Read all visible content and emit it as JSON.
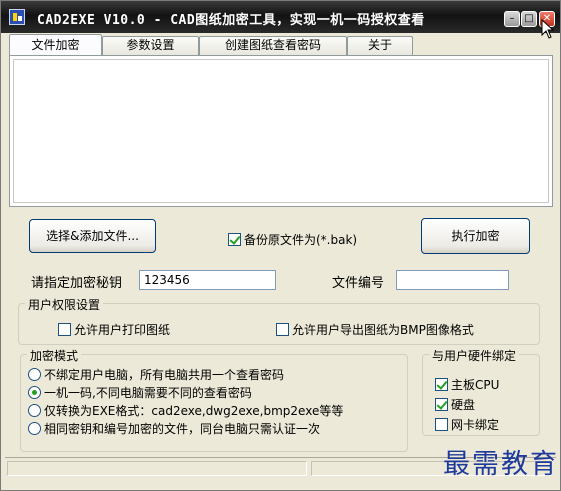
{
  "window": {
    "title": "CAD2EXE V10.0 - CAD图纸加密工具，实现一机一码授权查看",
    "min_glyph": "–",
    "max_glyph": "□",
    "close_glyph": "✕"
  },
  "tabs": [
    {
      "label": "文件加密",
      "active": true
    },
    {
      "label": "参数设置",
      "active": false
    },
    {
      "label": "创建图纸查看密码",
      "active": false
    },
    {
      "label": "关于",
      "active": false
    }
  ],
  "actions": {
    "select_label": "选择&添加文件...",
    "backup_label": "备份原文件为(*.bak)",
    "backup_checked": true,
    "encrypt_label": "执行加密"
  },
  "key": {
    "label": "请指定加密秘钥",
    "value": "123456"
  },
  "file_no": {
    "label": "文件编号",
    "value": ""
  },
  "permissions": {
    "title": "用户权限设置",
    "print_label": "允许用户打印图纸",
    "print_checked": false,
    "export_label": "允许用户导出图纸为BMP图像格式",
    "export_checked": false
  },
  "mode": {
    "title": "加密模式",
    "options": [
      {
        "label": "不绑定用户电脑，所有电脑共用一个查看密码",
        "selected": false
      },
      {
        "label": "一机一码,不同电脑需要不同的查看密码",
        "selected": true
      },
      {
        "label": "仅转换为EXE格式：cad2exe,dwg2exe,bmp2exe等等",
        "selected": false
      },
      {
        "label": "相同密钥和编号加密的文件，同台电脑只需认证一次",
        "selected": false
      }
    ]
  },
  "hardware": {
    "title": "与用户硬件绑定",
    "options": [
      {
        "label": "主板CPU",
        "checked": true
      },
      {
        "label": "硬盘",
        "checked": true
      },
      {
        "label": "网卡绑定",
        "checked": false
      }
    ]
  },
  "watermark": "最需教育",
  "colors": {
    "titlebar": "#121212",
    "check_green": "#21a121",
    "watermark": "#1e3a9a"
  }
}
